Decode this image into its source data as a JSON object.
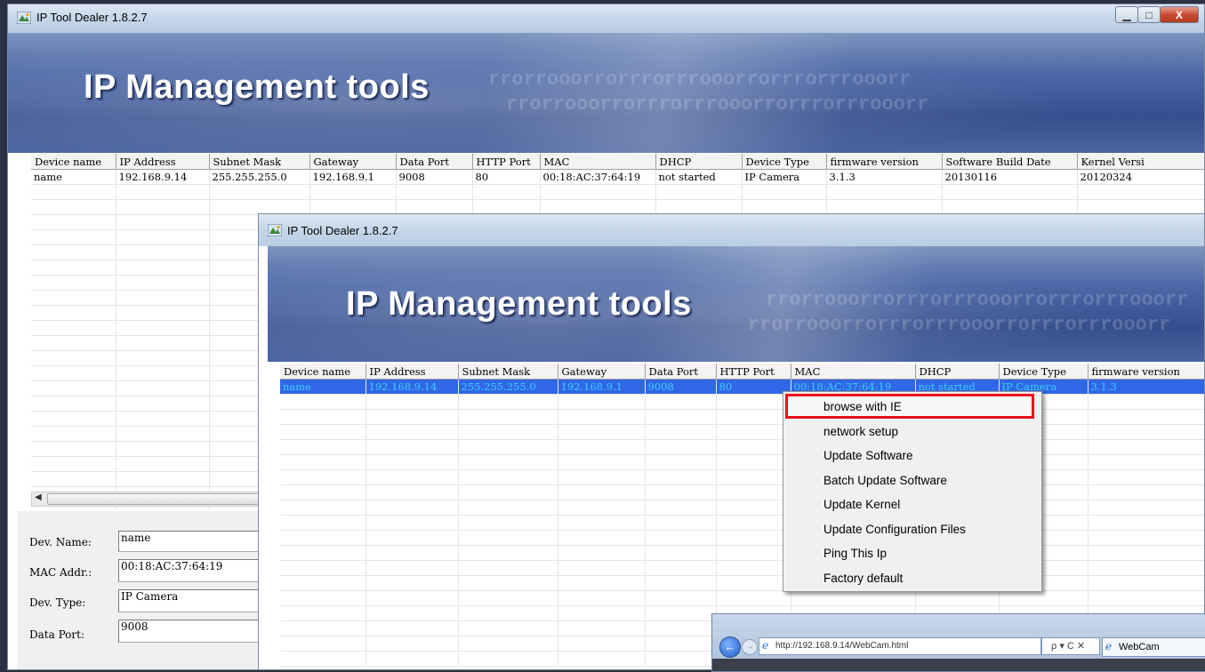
{
  "app": {
    "title": "IP Tool Dealer 1.8.2.7",
    "banner": "IP Management tools",
    "banner_pattern": "rrorrooorrorrrorrrooorrorrrorrrooorr"
  },
  "window_controls": {
    "minimize": "▁",
    "maximize": "□",
    "close": "X"
  },
  "table_back": {
    "columns": [
      "Device name",
      "IP Address",
      "Subnet Mask",
      "Gateway",
      "Data Port",
      "HTTP Port",
      "MAC",
      "DHCP",
      "Device Type",
      "firmware version",
      "Software Build Date",
      "Kernel Versi"
    ],
    "row": [
      "name",
      "192.168.9.14",
      "255.255.255.0",
      "192.168.9.1",
      "9008",
      "80",
      "00:18:AC:37:64:19",
      "not started",
      "IP Camera",
      "3.1.3",
      "20130116",
      "20120324"
    ]
  },
  "details": {
    "dev_name_label": "Dev. Name:",
    "dev_name": "name",
    "mac_label": "MAC Addr.:",
    "mac": "00:18:AC:37:64:19",
    "type_label": "Dev. Type:",
    "type": "IP Camera",
    "port_label": "Data Port:",
    "port": "9008"
  },
  "table_front": {
    "columns": [
      "Device name",
      "IP Address",
      "Subnet Mask",
      "Gateway",
      "Data Port",
      "HTTP Port",
      "MAC",
      "DHCP",
      "Device Type",
      "firmware version"
    ],
    "row": [
      "name",
      "192.168.9.14",
      "255.255.255.0",
      "192.168.9.1",
      "9008",
      "80",
      "00:18:AC:37:64:19",
      "not started",
      "IP Camera",
      "3.1.3"
    ]
  },
  "context_menu": {
    "items": [
      "browse with IE",
      "network setup",
      "Update Software",
      "Batch Update Software",
      "Update Kernel",
      "Update Configuration Files",
      "Ping This Ip",
      "Factory default"
    ]
  },
  "browser": {
    "url": "http://192.168.9.14/WebCam.html",
    "search": "ρ ▾ C ✕",
    "tab": "WebCam"
  },
  "colors": {
    "selection": "#3067e6",
    "highlight_box": "#e8101e"
  }
}
